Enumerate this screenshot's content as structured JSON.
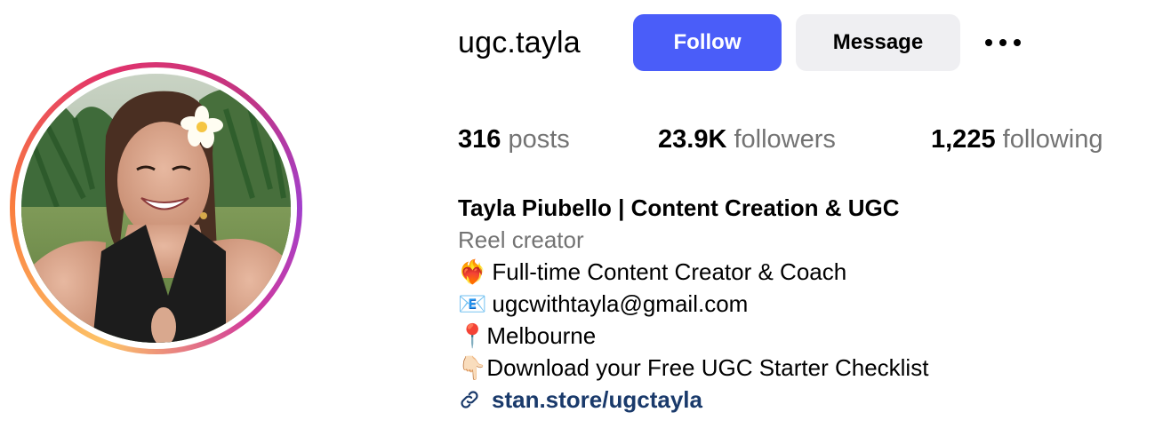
{
  "profile": {
    "username": "ugc.tayla",
    "follow_label": "Follow",
    "message_label": "Message",
    "more_icon": "more-horizontal-icon"
  },
  "stats": {
    "posts_count": "316",
    "posts_label": "posts",
    "followers_count": "23.9K",
    "followers_label": "followers",
    "following_count": "1,225",
    "following_label": "following"
  },
  "bio": {
    "name": "Tayla Piubello | Content Creation & UGC",
    "category": "Reel creator",
    "lines": [
      {
        "icon": "heart-on-fire-emoji",
        "glyph": "❤️‍🔥",
        "text": " Full-time Content Creator & Coach"
      },
      {
        "icon": "envelope-emoji",
        "glyph": "📧",
        "text": " ugcwithtayla@gmail.com"
      },
      {
        "icon": "round-pushpin-emoji",
        "glyph": "📍",
        "text": "Melbourne"
      },
      {
        "icon": "backhand-index-pointing-down-emoji",
        "glyph": "👇🏻",
        "text": "Download your Free UGC Starter Checklist"
      }
    ],
    "link_icon": "link-icon",
    "link_text": "stan.store/ugctayla"
  },
  "colors": {
    "follow_button": "#4a5df9",
    "message_button": "#efeff2",
    "secondary_text": "#737373",
    "link_text": "#1a3a6b"
  }
}
